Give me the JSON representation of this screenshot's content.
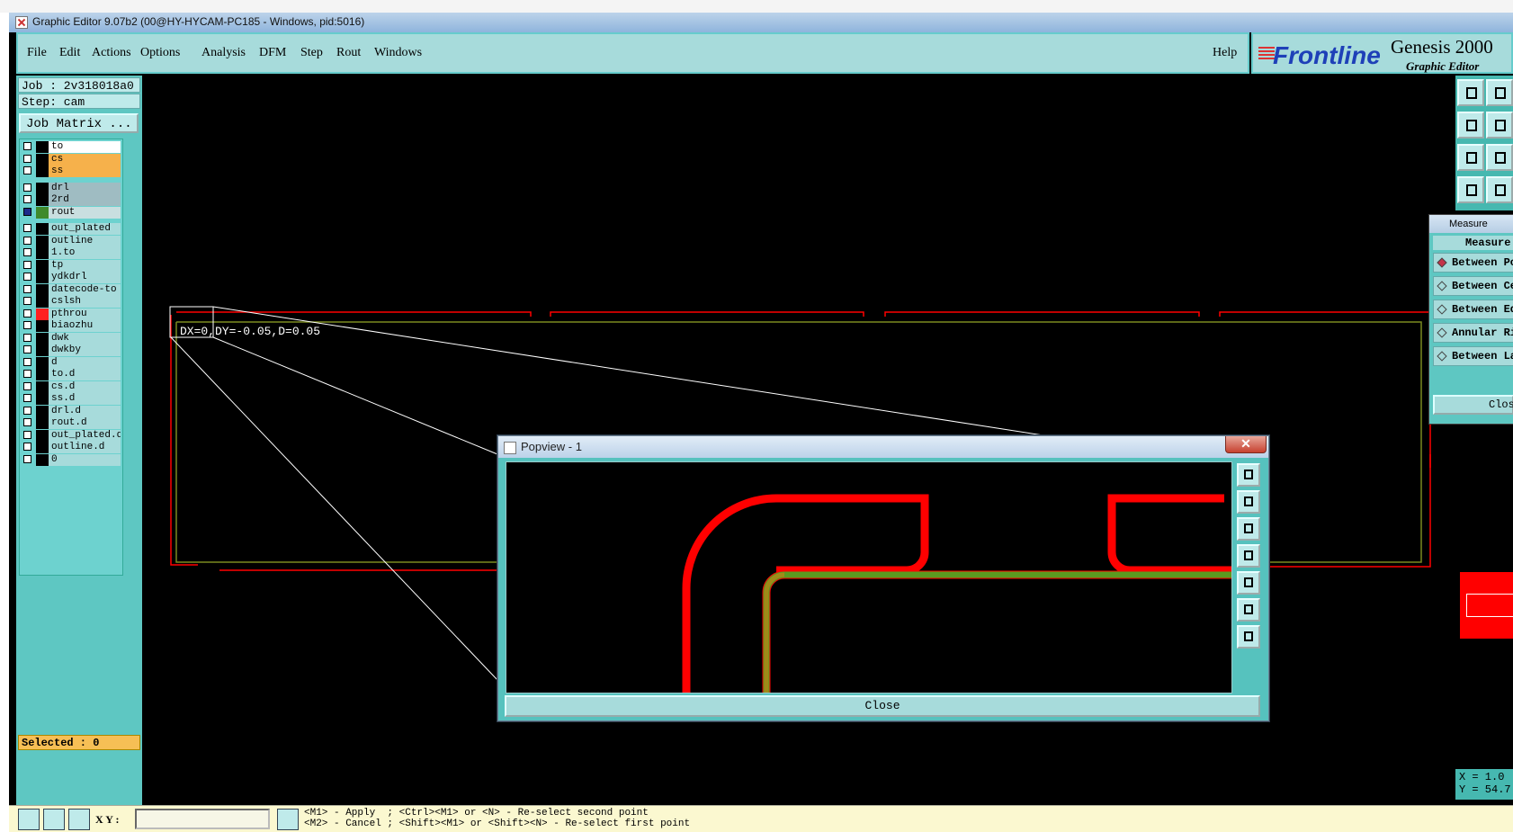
{
  "window": {
    "title": "Graphic Editor 9.07b2 (00@HY-HYCAM-PC185 - Windows, pid:5016)"
  },
  "menu": {
    "items": [
      "File",
      "Edit",
      "Actions",
      "Options",
      "Analysis",
      "DFM",
      "Step",
      "Rout",
      "Windows"
    ],
    "help": "Help"
  },
  "brand": {
    "logo": "Frontline",
    "title": "Genesis 2000",
    "subtitle": "Graphic Editor"
  },
  "job": {
    "job": "Job : 2v318018a0",
    "step": "Step: cam",
    "matrix_button": "Job Matrix ..."
  },
  "layers": [
    {
      "name": "to",
      "color": "#ffffff",
      "sw": "#000000"
    },
    {
      "name": "cs",
      "color": "#f6b14b",
      "sw": "#000000"
    },
    {
      "name": "ss",
      "color": "#f6b14b",
      "sw": "#000000"
    },
    {
      "name": "drl",
      "color": "#9fbcc2",
      "sw": "#000000"
    },
    {
      "name": "2rd",
      "color": "#9fbcc2",
      "sw": "#000000"
    },
    {
      "name": "rout",
      "color": "#c9dfe0",
      "sw": "#3f8a2c",
      "active": true
    },
    {
      "name": "out_plated",
      "color": "#a7dbdb",
      "sw": "#000000"
    },
    {
      "name": "outline",
      "color": "#a7dbdb",
      "sw": "#000000"
    },
    {
      "name": "1.to",
      "color": "#a7dbdb",
      "sw": "#000000"
    },
    {
      "name": "tp",
      "color": "#a7dbdb",
      "sw": "#000000"
    },
    {
      "name": "ydkdrl",
      "color": "#a7dbdb",
      "sw": "#000000"
    },
    {
      "name": "datecode-to",
      "color": "#a7dbdb",
      "sw": "#000000"
    },
    {
      "name": "cslsh",
      "color": "#a7dbdb",
      "sw": "#000000"
    },
    {
      "name": "pthrou",
      "color": "#a7dbdb",
      "sw": "#ff2020"
    },
    {
      "name": "biaozhu",
      "color": "#a7dbdb",
      "sw": "#000000"
    },
    {
      "name": "dwk",
      "color": "#a7dbdb",
      "sw": "#000000"
    },
    {
      "name": "dwkby",
      "color": "#a7dbdb",
      "sw": "#000000"
    },
    {
      "name": "d",
      "color": "#a7dbdb",
      "sw": "#000000"
    },
    {
      "name": "to.d",
      "color": "#a7dbdb",
      "sw": "#000000"
    },
    {
      "name": "cs.d",
      "color": "#a7dbdb",
      "sw": "#000000"
    },
    {
      "name": "ss.d",
      "color": "#a7dbdb",
      "sw": "#000000"
    },
    {
      "name": "drl.d",
      "color": "#a7dbdb",
      "sw": "#000000"
    },
    {
      "name": "rout.d",
      "color": "#a7dbdb",
      "sw": "#000000"
    },
    {
      "name": "out_plated.d",
      "color": "#a7dbdb",
      "sw": "#000000"
    },
    {
      "name": "outline.d",
      "color": "#a7dbdb",
      "sw": "#000000"
    },
    {
      "name": "0",
      "color": "#a7dbdb",
      "sw": "#000000"
    }
  ],
  "selected": "Selected : 0",
  "canvas": {
    "measure_readout": "DX=0,DY=-0.05,D=0.05"
  },
  "measure_popup": {
    "title": "Measure Popup",
    "header": "Measure",
    "options": [
      "Between Points",
      "Between Centers",
      "Between Edges",
      "Annular Ring",
      "Between Layers"
    ],
    "close": "Close"
  },
  "coords": {
    "x": "X = 1.0",
    "y": "Y = 54.7"
  },
  "popview": {
    "title": "Popview - 1",
    "close_button": "Close",
    "close_x": "✕"
  },
  "status": {
    "xy_label": "X Y :",
    "xy_value": "",
    "hint_line1": "<M1> - Apply  ; <Ctrl><M1> or <N> - Re-select second point",
    "hint_line2": "<M2> - Cancel ; <Shift><M1> or <Shift><N> - Re-select first point"
  },
  "colors": {
    "pcb_red": "#ff0000",
    "rout_green": "#5a9a20",
    "outline_green": "#7a8a20",
    "panel_teal": "#5ec7c2"
  }
}
